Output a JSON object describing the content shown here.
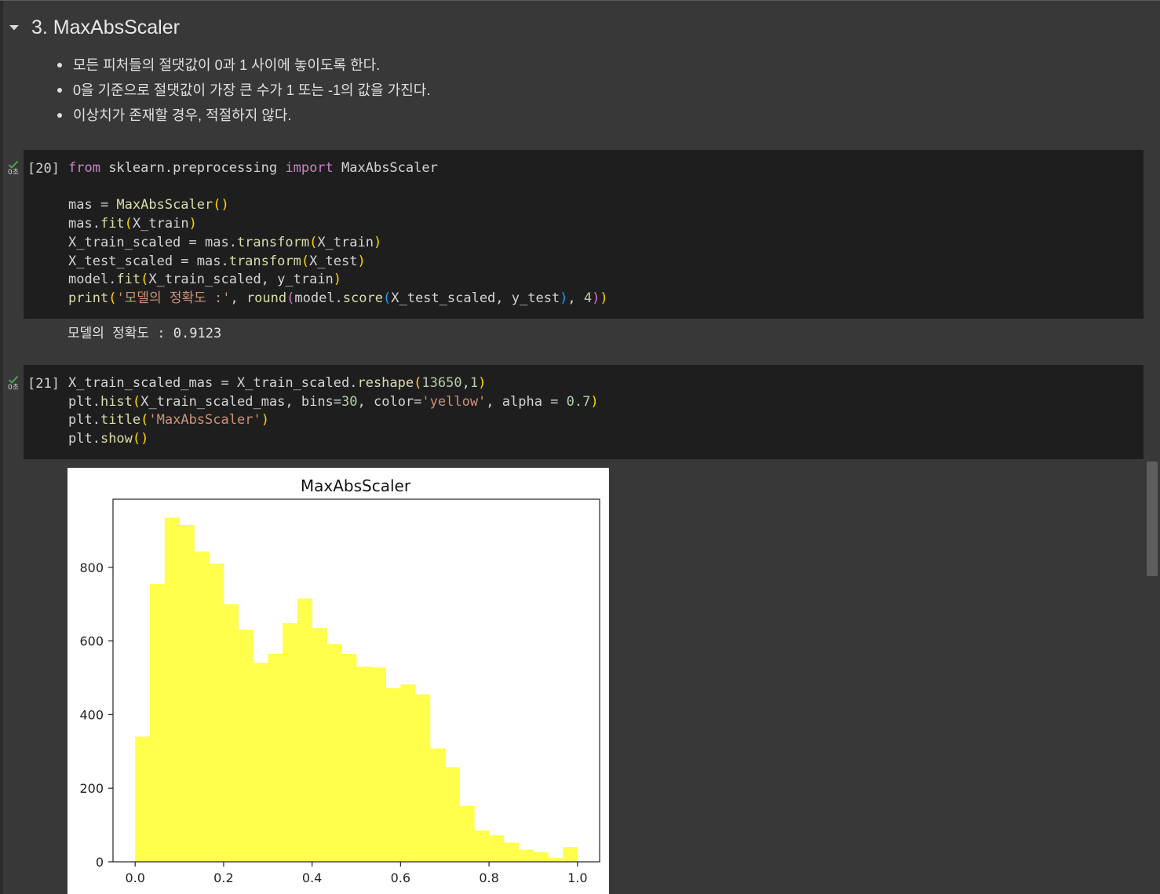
{
  "section": {
    "title": "3. MaxAbsScaler"
  },
  "bullets": [
    "모든 피처들의 절댓값이 0과 1 사이에 놓이도록 한다.",
    "0을 기준으로 절댓값이 가장 큰 수가 1 또는 -1의 값을 가진다.",
    "이상치가 존재할 경우, 적절하지 않다."
  ],
  "cells": [
    {
      "exec_count": "[20]",
      "status_time": "0초",
      "code_lines": [
        "from sklearn.preprocessing import MaxAbsScaler",
        "",
        "mas = MaxAbsScaler()",
        "mas.fit(X_train)",
        "X_train_scaled = mas.transform(X_train)",
        "X_test_scaled = mas.transform(X_test)",
        "model.fit(X_train_scaled, y_train)",
        "print('모델의 정확도 :', round(model.score(X_test_scaled, y_test), 4))"
      ],
      "output": "모델의 정확도 : 0.9123"
    },
    {
      "exec_count": "[21]",
      "status_time": "0초",
      "code_lines": [
        "X_train_scaled_mas = X_train_scaled.reshape(13650,1)",
        "plt.hist(X_train_scaled_mas, bins=30, color='yellow', alpha = 0.7)",
        "plt.title('MaxAbsScaler')",
        "plt.show()"
      ]
    }
  ],
  "colors": {
    "background": "#383838",
    "code_background": "#1e1e1e",
    "bar_color": "#ffff4c",
    "check_color": "#4caf50"
  },
  "chart_data": {
    "type": "bar",
    "title": "MaxAbsScaler",
    "xlabel": "",
    "ylabel": "",
    "bin_start": 0.0,
    "bin_width": 0.03333,
    "values": [
      340,
      755,
      935,
      915,
      843,
      810,
      700,
      630,
      540,
      565,
      648,
      715,
      635,
      592,
      565,
      530,
      528,
      472,
      482,
      455,
      308,
      257,
      152,
      85,
      72,
      52,
      33,
      27,
      10,
      40
    ],
    "xlim": [
      -0.05,
      1.05
    ],
    "ylim": [
      0,
      985
    ],
    "xticks": [
      0.0,
      0.2,
      0.4,
      0.6,
      0.8,
      1.0
    ],
    "xtick_labels": [
      "0.0",
      "0.2",
      "0.4",
      "0.6",
      "0.8",
      "1.0"
    ],
    "yticks": [
      0,
      200,
      400,
      600,
      800
    ],
    "ytick_labels": [
      "0",
      "200",
      "400",
      "600",
      "800"
    ],
    "grid": false
  }
}
